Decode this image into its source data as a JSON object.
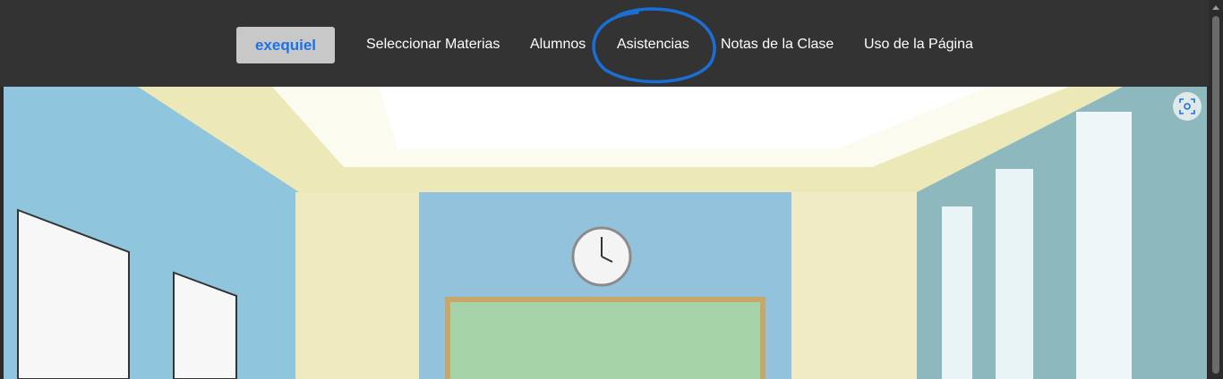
{
  "nav": {
    "brand": "exequiel",
    "links": [
      "Seleccionar Materias",
      "Alumnos",
      "Asistencias",
      "Notas de la Clase",
      "Uso de la Página"
    ]
  },
  "hero": {
    "image": "classroom-illustration"
  },
  "colors": {
    "topbar": "#333333",
    "brand_text": "#1a73e8",
    "annotation": "#1a6fd6"
  }
}
